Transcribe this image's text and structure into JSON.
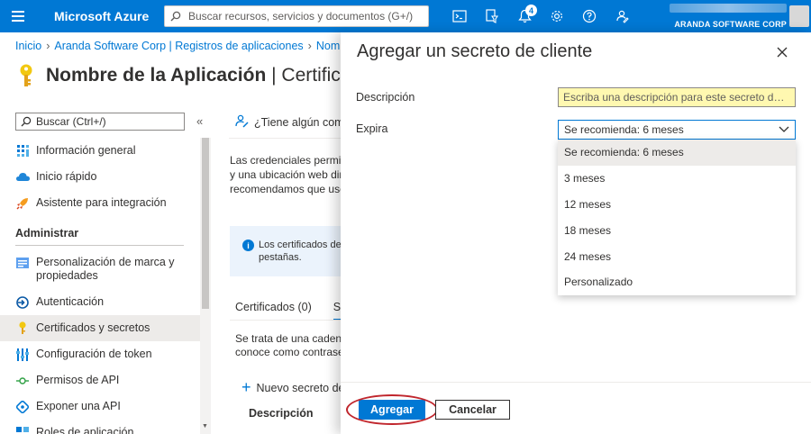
{
  "topbar": {
    "brand": "Microsoft Azure",
    "search_placeholder": "Buscar recursos, servicios y documentos (G+/)",
    "notifications_count": "4",
    "account_org": "ARANDA SOFTWARE CORP",
    "accent": "#0078d4"
  },
  "breadcrumb": {
    "home": "Inicio",
    "org": "Aranda Software Corp | Registros de aplicaciones",
    "app": "Nom"
  },
  "page": {
    "title_main": "Nombre de la Aplicación",
    "title_sub": "| Certificad"
  },
  "sidebar": {
    "search_placeholder": "Buscar (Ctrl+/)",
    "collapse": "«",
    "items_top": [
      {
        "label": "Información general",
        "icon": "overview-icon"
      },
      {
        "label": "Inicio rápido",
        "icon": "quickstart-icon"
      },
      {
        "label": "Asistente para integración",
        "icon": "rocket-icon"
      }
    ],
    "section_manage": "Administrar",
    "items_manage": [
      {
        "label": "Personalización de marca y propiedades",
        "icon": "branding-icon"
      },
      {
        "label": "Autenticación",
        "icon": "authentication-icon"
      },
      {
        "label": "Certificados y secretos",
        "icon": "key-icon"
      },
      {
        "label": "Configuración de token",
        "icon": "token-icon"
      },
      {
        "label": "Permisos de API",
        "icon": "api-permissions-icon"
      },
      {
        "label": "Exponer una API",
        "icon": "expose-api-icon"
      },
      {
        "label": "Roles de aplicación",
        "icon": "app-roles-icon"
      }
    ]
  },
  "main": {
    "feedback": "¿Tiene algún come",
    "desc_lines": [
      "Las credenciales permite",
      "y una ubicación web dir",
      "recomendamos que use"
    ],
    "info_lines": [
      "Los certificados de",
      "pestañas."
    ],
    "tabs": [
      "Certificados (0)",
      "S"
    ],
    "secret_desc_lines": [
      "Se trata de una cadena",
      "conoce como contrase"
    ],
    "new_secret": "Nuevo secreto de",
    "col_description": "Descripción"
  },
  "panel": {
    "title": "Agregar un secreto de cliente",
    "description_label": "Descripción",
    "description_placeholder": "Escriba una descripción para este secreto de cl...",
    "expires_label": "Expira",
    "expires_value": "Se recomienda: 6 meses",
    "options": [
      "Se recomienda: 6 meses",
      "3 meses",
      "12 meses",
      "18 meses",
      "24 meses",
      "Personalizado"
    ],
    "add_label": "Agregar",
    "cancel_label": "Cancelar",
    "highlight_color": "#c0262d"
  }
}
